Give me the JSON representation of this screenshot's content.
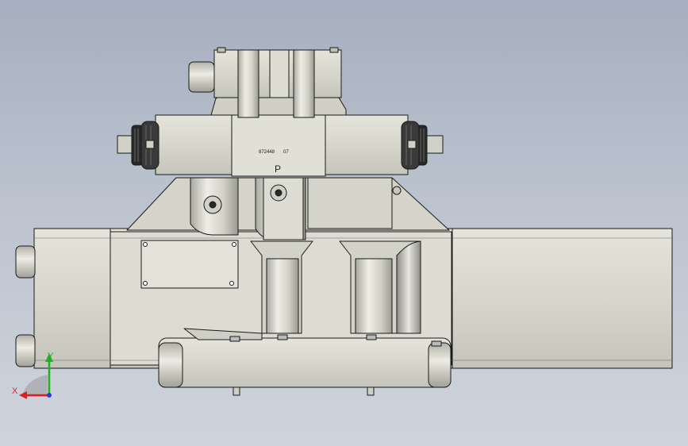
{
  "model": {
    "serial_text": "872448",
    "code_text": "07",
    "port_label": "P"
  },
  "triad": {
    "x_label": "X",
    "y_label": "Y",
    "x_color": "#e02020",
    "y_color": "#20b020",
    "z_color": "#2040e0"
  },
  "colors": {
    "body_fill": "#dcdcd2",
    "edge": "#1a1a1a",
    "dark_ring": "#2a2a2a"
  }
}
